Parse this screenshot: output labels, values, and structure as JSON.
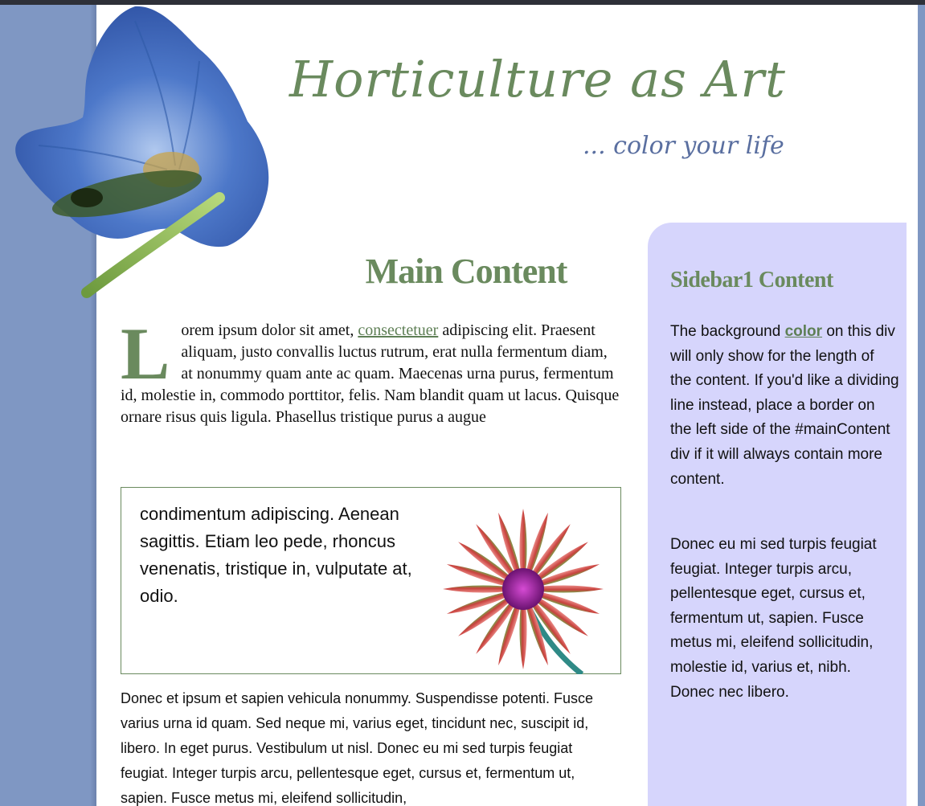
{
  "header": {
    "logo_title": "Horticulture as Art",
    "logo_tagline": "... color your life"
  },
  "main": {
    "title": "Main Content",
    "intro": {
      "dropcap": "L",
      "text_before_link": "orem ipsum dolor sit amet, ",
      "link_text": "consectetuer",
      "text_after_link": " adipiscing elit. Praesent aliquam, justo convallis luctus rutrum, erat nulla fermentum diam, at nonummy quam ante ac quam. Maecenas urna purus, fermentum id, molestie in, commodo porttitor, felis. Nam blandit quam ut lacus. Quisque ornare risus quis ligula. Phasellus tristique purus a augue"
    },
    "boxed_text": "condimentum adipiscing. Aenean sagittis. Etiam leo pede, rhoncus venenatis, tristique in, vulputate at, odio.",
    "body_text": "Donec et ipsum et sapien vehicula nonummy. Suspendisse potenti. Fusce varius urna id quam. Sed neque mi, varius eget, tincidunt nec, suscipit id, libero. In eget purus. Vestibulum ut nisl. Donec eu mi sed turpis feugiat feugiat. Integer turpis arcu, pellentesque eget, cursus et, fermentum ut, sapien. Fusce metus mi, eleifend sollicitudin,"
  },
  "sidebar": {
    "title": "Sidebar1 Content",
    "p1_before_link": "The background ",
    "p1_link": "color",
    "p1_after_link": " on this div will only show for the length of the content. If you'd like a dividing line instead, place a border on the left side of the #mainContent div if it will always contain more content.",
    "p2": "Donec eu mi sed turpis feugiat feugiat. Integer turpis arcu, pellentesque eget, cursus et, fermentum ut, sapien. Fusce metus mi, eleifend sollicitudin, molestie id, varius et, nibh. Donec nec libero."
  },
  "colors": {
    "page_background": "#7f97c3",
    "accent_green": "#6a8a5e",
    "sidebar_background": "#d6d5fc"
  },
  "icons": {
    "hero_image": "blue-poppy-flower-image",
    "box_image": "red-daisy-flower-image"
  }
}
